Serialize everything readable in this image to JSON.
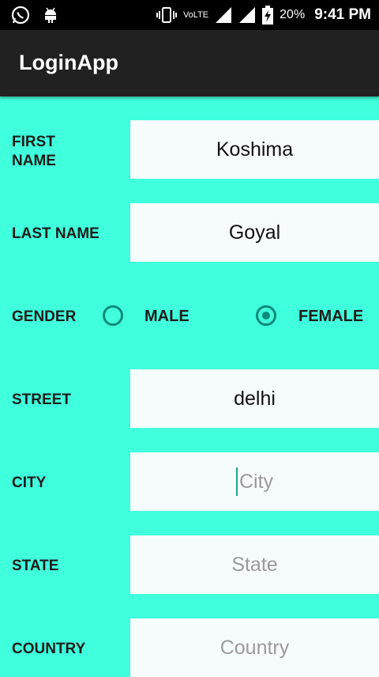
{
  "status_bar": {
    "battery_percent": "20%",
    "time": "9:41 PM",
    "network": "VoLTE",
    "icons": [
      "whatsapp-icon",
      "android-icon",
      "vibrate-icon",
      "signal-icon",
      "signal-icon",
      "battery-charging-icon"
    ]
  },
  "app_bar": {
    "title": "LoginApp"
  },
  "form": {
    "first_name": {
      "label": "FIRST NAME",
      "value": "Koshima"
    },
    "last_name": {
      "label": "LAST NAME",
      "value": "Goyal"
    },
    "gender": {
      "label": "GENDER",
      "options": [
        {
          "label": "MALE",
          "selected": false
        },
        {
          "label": "FEMALE",
          "selected": true
        }
      ]
    },
    "street": {
      "label": "STREET",
      "value": "delhi"
    },
    "city": {
      "label": "CITY",
      "placeholder": "City"
    },
    "state": {
      "label": "STATE",
      "placeholder": "State"
    },
    "country": {
      "label": "COUNTRY",
      "placeholder": "Country"
    }
  },
  "colors": {
    "background": "#40ffdc",
    "app_bar": "#212121",
    "accent": "#0d8a78"
  }
}
